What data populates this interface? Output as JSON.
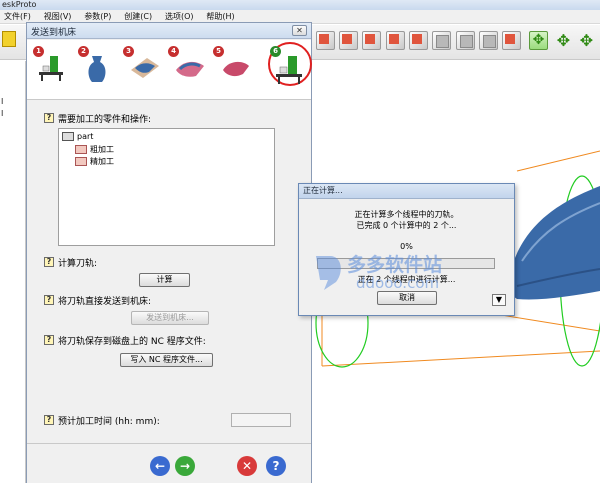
{
  "app": {
    "title": "eskProto",
    "menu": [
      "文件(F)",
      "视图(V)",
      "参数(P)",
      "创建(C)",
      "选项(O)",
      "帮助(H)"
    ]
  },
  "left_strip": {
    "marks": [
      "I",
      "I"
    ]
  },
  "wizard": {
    "title": "发送到机床",
    "close_label": "✕",
    "steps": [
      "1",
      "2",
      "3",
      "4",
      "5",
      "6"
    ],
    "step_colors": [
      "#c62f2f",
      "#c62f2f",
      "#c62f2f",
      "#c62f2f",
      "#c62f2f",
      "#2a8a2a"
    ],
    "sections": {
      "parts_label": "需要加工的零件和操作:",
      "toolpath_label": "计算刀轨:",
      "compute_button": "计算",
      "send_label": "将刀轨直接发送到机床:",
      "send_button": "发送到机床...",
      "save_label": "将刀轨保存到磁盘上的 NC 程序文件:",
      "write_button": "写入 NC 程序文件...",
      "time_label": "预计加工时间 (hh: mm):",
      "time_value": ""
    },
    "tree": [
      {
        "label": "part",
        "level": 0
      },
      {
        "label": "粗加工",
        "level": 1
      },
      {
        "label": "精加工",
        "level": 1
      }
    ],
    "footer": {
      "back": "←",
      "next": "→",
      "cancel": "✕",
      "help": "?"
    }
  },
  "progress_dialog": {
    "title": "正在计算...",
    "line1": "正在计算多个线程中的刀轨。",
    "line2": "已完成 0 个计算中的 2 个...",
    "percent_text": "0%",
    "percent_value": 0,
    "status": "正在 2 个线程中进行计算...",
    "cancel_button": "取消",
    "toggle": "▼"
  },
  "watermark": {
    "text": "多多软件站",
    "url": "ddooo.com"
  },
  "colors": {
    "accent_red": "#e02020",
    "progress_green": "#3ba53b",
    "model_blue": "#3a6aa8",
    "guide_green": "#22cc22",
    "guide_orange": "#f08a20"
  }
}
